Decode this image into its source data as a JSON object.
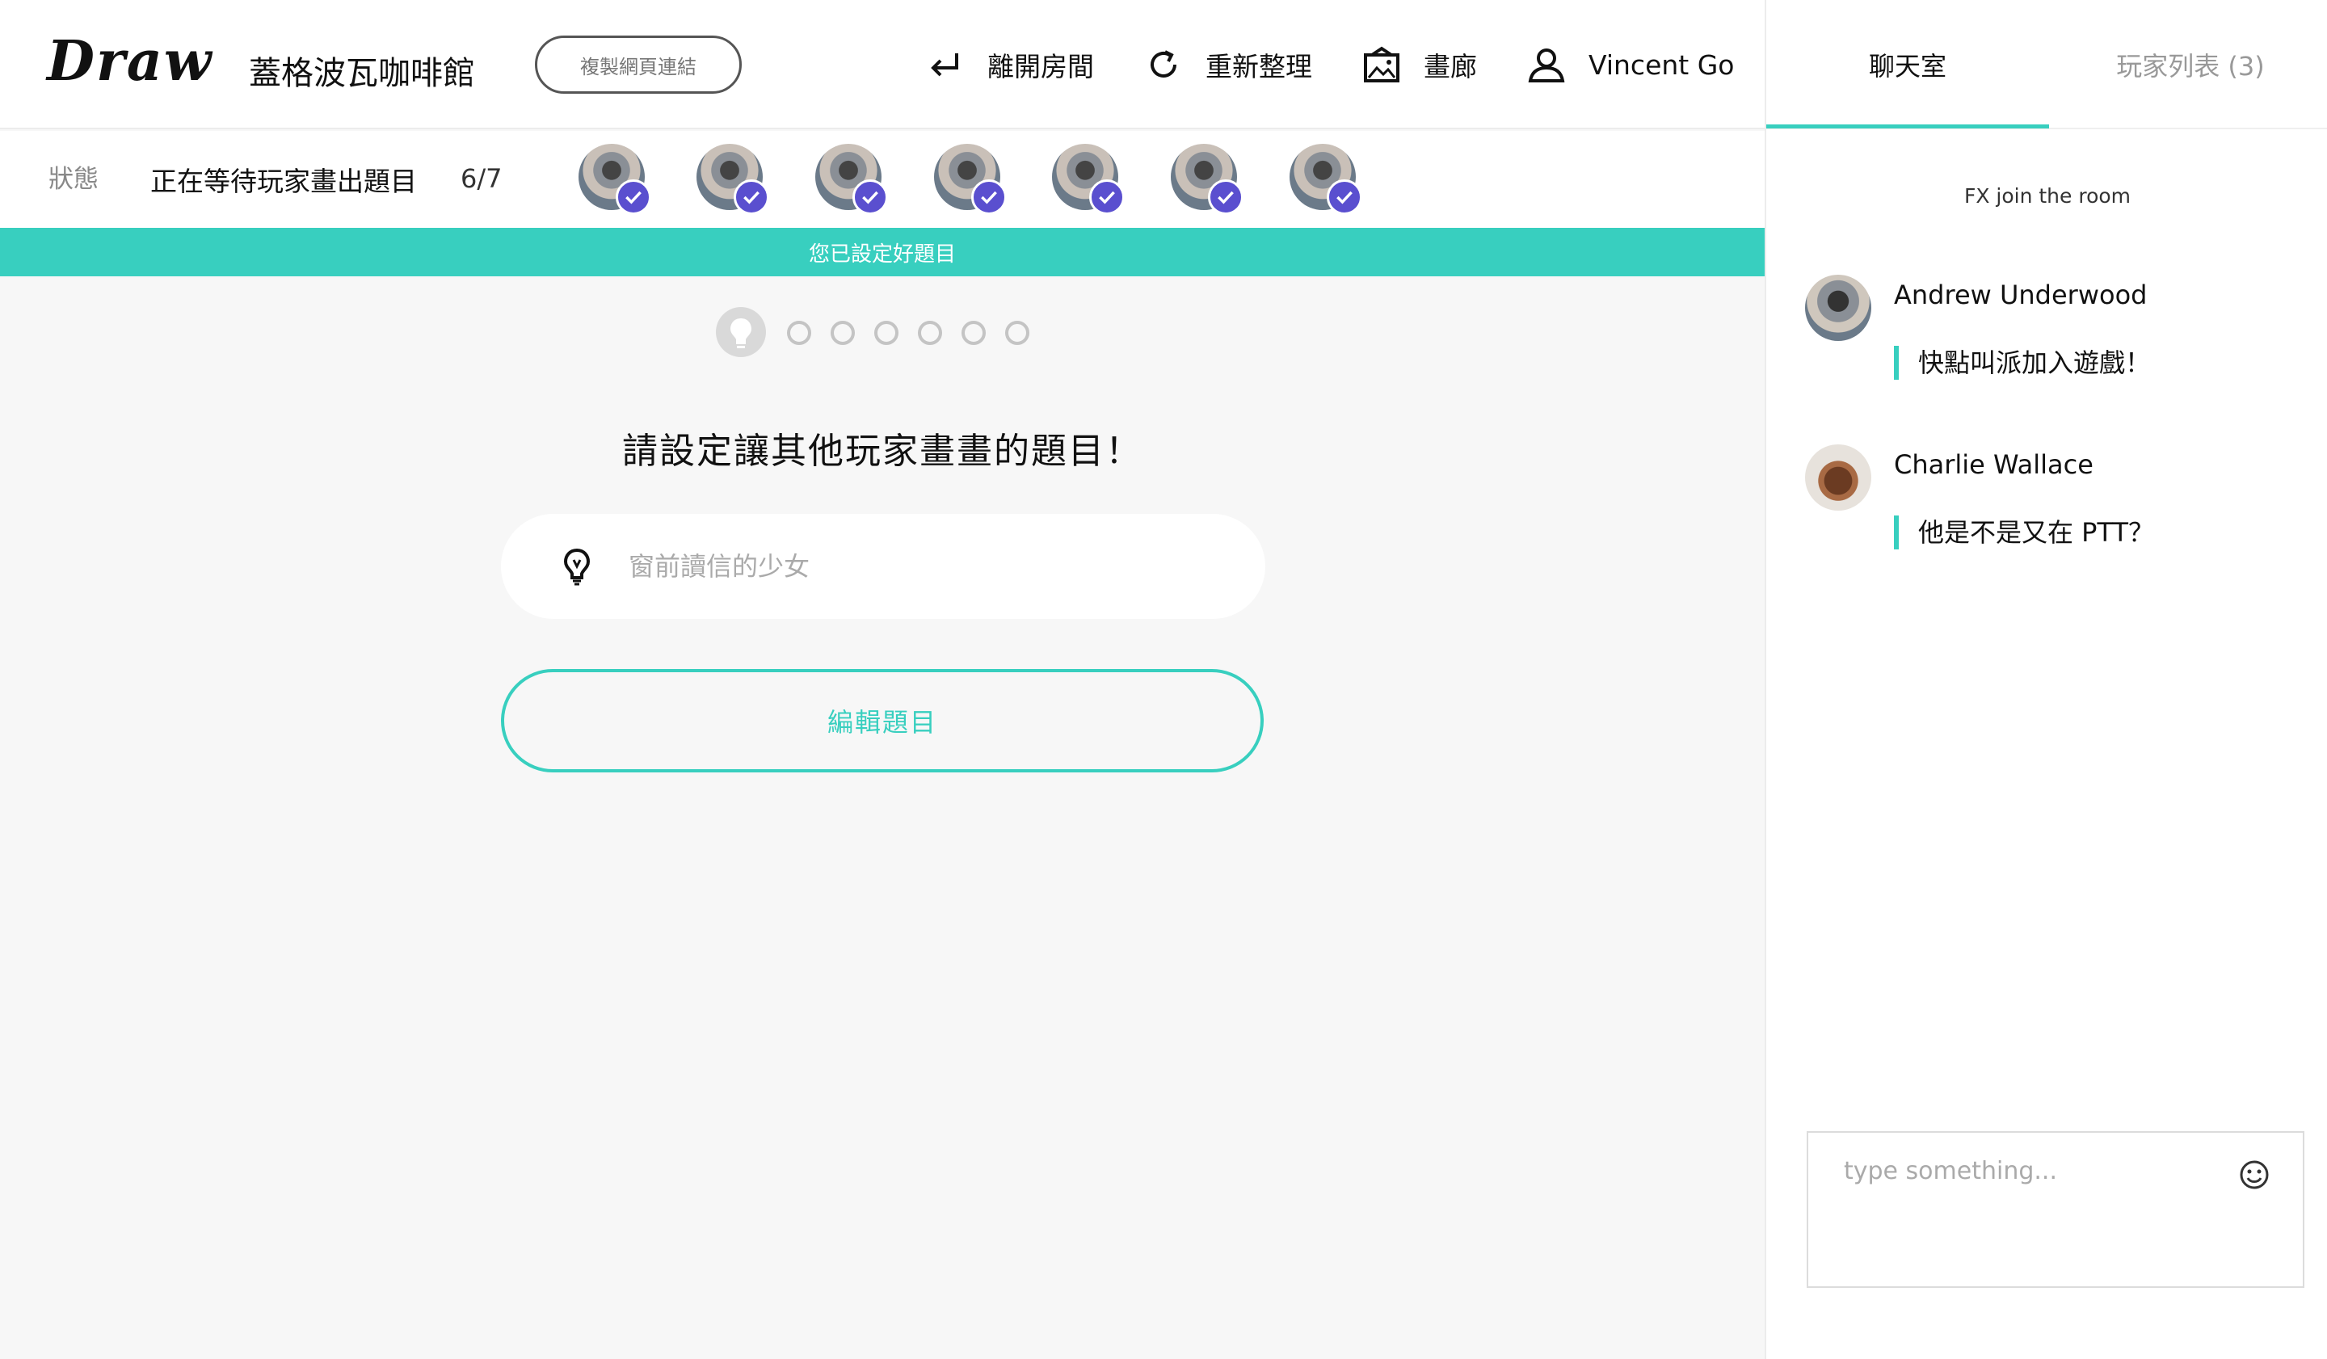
{
  "app": {
    "logo": "Draw",
    "room_name": "蓋格波瓦咖啡館",
    "copy_link_label": "複製網頁連結"
  },
  "nav": {
    "leave_label": "離開房間",
    "refresh_label": "重新整理",
    "gallery_label": "畫廊",
    "user_label": "Vincent Go"
  },
  "status": {
    "label": "狀態",
    "text": "正在等待玩家畫出題目",
    "count": "6/7"
  },
  "notice": "您已設定好題目",
  "progress": {
    "current_step": 1,
    "total_steps": 7
  },
  "prompt": {
    "heading": "請設定讓其他玩家畫畫的題目！",
    "input_placeholder": "窗前讀信的少女",
    "edit_button": "編輯題目"
  },
  "side": {
    "tab_chat": "聊天室",
    "tab_players": "玩家列表 (3)",
    "system_message": "FX join the room",
    "messages": [
      {
        "name": "Andrew Underwood",
        "text": "快點叫派加入遊戲！"
      },
      {
        "name": "Charlie Wallace",
        "text": "他是不是又在 PTT？"
      }
    ],
    "input_placeholder": "type something..."
  },
  "colors": {
    "accent": "#38cfbf",
    "check_badge": "#5a4fcf"
  }
}
